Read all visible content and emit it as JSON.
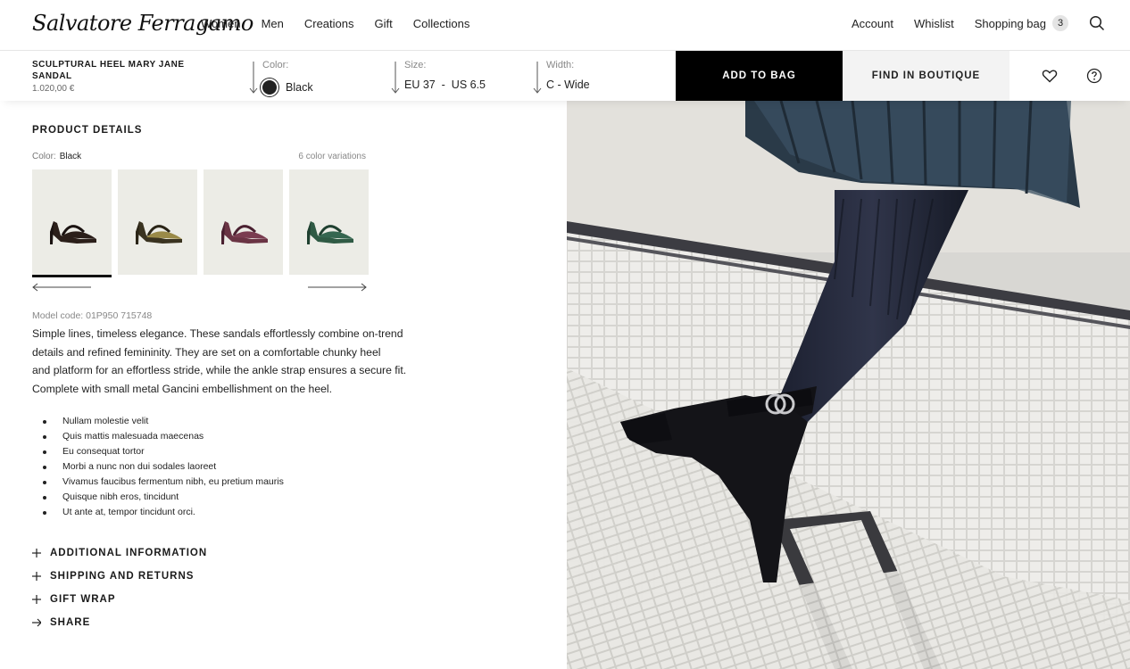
{
  "header": {
    "logo": "Salvatore Ferragamo",
    "nav": [
      "Women",
      "Men",
      "Creations",
      "Gift",
      "Collections"
    ],
    "account": "Account",
    "wishlist": "Whislist",
    "bag_label": "Shopping bag",
    "bag_count": "3",
    "search_icon": "search-icon"
  },
  "product_bar": {
    "name": "SCULPTURAL HEEL MARY JANE SANDAL",
    "price": "1.020,00 €",
    "color_label": "Color:",
    "color_value": "Black",
    "size_label": "Size:",
    "size_value": "EU 37  -  US 6.5",
    "width_label": "Width:",
    "width_value": "C - Wide",
    "add_to_bag": "ADD TO BAG",
    "find_in_boutique": "FIND IN BOUTIQUE",
    "icons": [
      "heart-icon",
      "help-icon"
    ]
  },
  "details": {
    "title": "PRODUCT DETAILS",
    "color_label": "Color:",
    "color_value": "Black",
    "variations": "6 color variations",
    "thumbnails": [
      {
        "color": "#2b1f1a",
        "accent": "#1a1210"
      },
      {
        "color": "#3a3320",
        "accent": "#9a8a48"
      },
      {
        "color": "#6a3444",
        "accent": "#4a2030"
      },
      {
        "color": "#2f5a44",
        "accent": "#1f4030"
      }
    ],
    "model_code": "Model code: 01P950 715748",
    "description": [
      "Simple lines, timeless elegance. These sandals effortlessly combine on-trend",
      "details and refined femininity. They are set on a comfortable chunky heel",
      "and platform for an effortless stride, while the ankle strap ensures a secure fit.",
      "Complete with small metal Gancini embellishment on the heel."
    ],
    "bullets": [
      "Nullam molestie velit",
      "Quis mattis malesuada maecenas",
      "Eu consequat tortor",
      "Morbi a nunc non dui sodales laoreet",
      "Vivamus faucibus fermentum nibh, eu pretium mauris",
      "Quisque nibh eros, tincidunt",
      "Ut ante at, tempor tincidunt orci."
    ]
  },
  "accordion": [
    {
      "label": "ADDITIONAL INFORMATION",
      "icon": "plus-icon"
    },
    {
      "label": "SHIPPING AND RETURNS",
      "icon": "plus-icon"
    },
    {
      "label": "GIFT WRAP",
      "icon": "plus-icon"
    },
    {
      "label": "SHARE",
      "icon": "arrow-right-icon"
    }
  ],
  "colors": {
    "accent": "#000000",
    "secondary_button": "#f3f3f3",
    "thumb_bg": "#ecece6"
  }
}
